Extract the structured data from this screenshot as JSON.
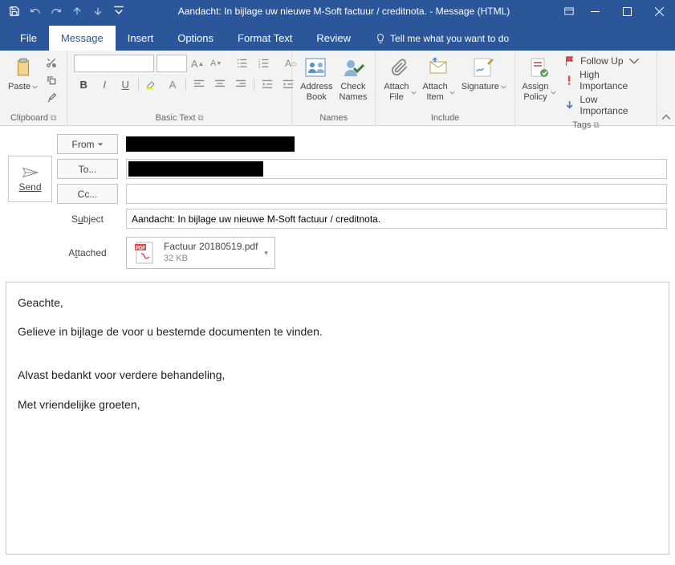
{
  "window": {
    "title": "Aandacht: In bijlage uw nieuwe M-Soft factuur / creditnota.  -  Message (HTML)"
  },
  "tabs": {
    "file": "File",
    "message": "Message",
    "insert": "Insert",
    "options": "Options",
    "format_text": "Format Text",
    "review": "Review",
    "tellme": "Tell me what you want to do"
  },
  "ribbon": {
    "clipboard": {
      "label": "Clipboard",
      "paste": "Paste"
    },
    "basic_text": {
      "label": "Basic Text"
    },
    "names": {
      "label": "Names",
      "address_book": "Address\nBook",
      "check_names": "Check\nNames"
    },
    "include": {
      "label": "Include",
      "attach_file": "Attach\nFile",
      "attach_item": "Attach\nItem",
      "signature": "Signature"
    },
    "tags": {
      "label": "Tags",
      "assign_policy": "Assign\nPolicy",
      "follow_up": "Follow Up",
      "high": "High Importance",
      "low": "Low Importance"
    }
  },
  "compose": {
    "send": "Send",
    "from_btn": "From",
    "to_btn": "To...",
    "cc_btn": "Cc...",
    "subject_label": "Subject",
    "subject_value": "Aandacht: In bijlage uw nieuwe M-Soft factuur / creditnota.",
    "attached_label": "Attached",
    "attachment": {
      "name": "Factuur       20180519.pdf",
      "size": "32 KB"
    }
  },
  "body": {
    "p1": "Geachte,",
    "p2": "Gelieve in bijlage de voor u bestemde documenten te vinden.",
    "p3": "Alvast bedankt voor verdere behandeling,",
    "p4": "Met vriendelijke groeten,"
  }
}
